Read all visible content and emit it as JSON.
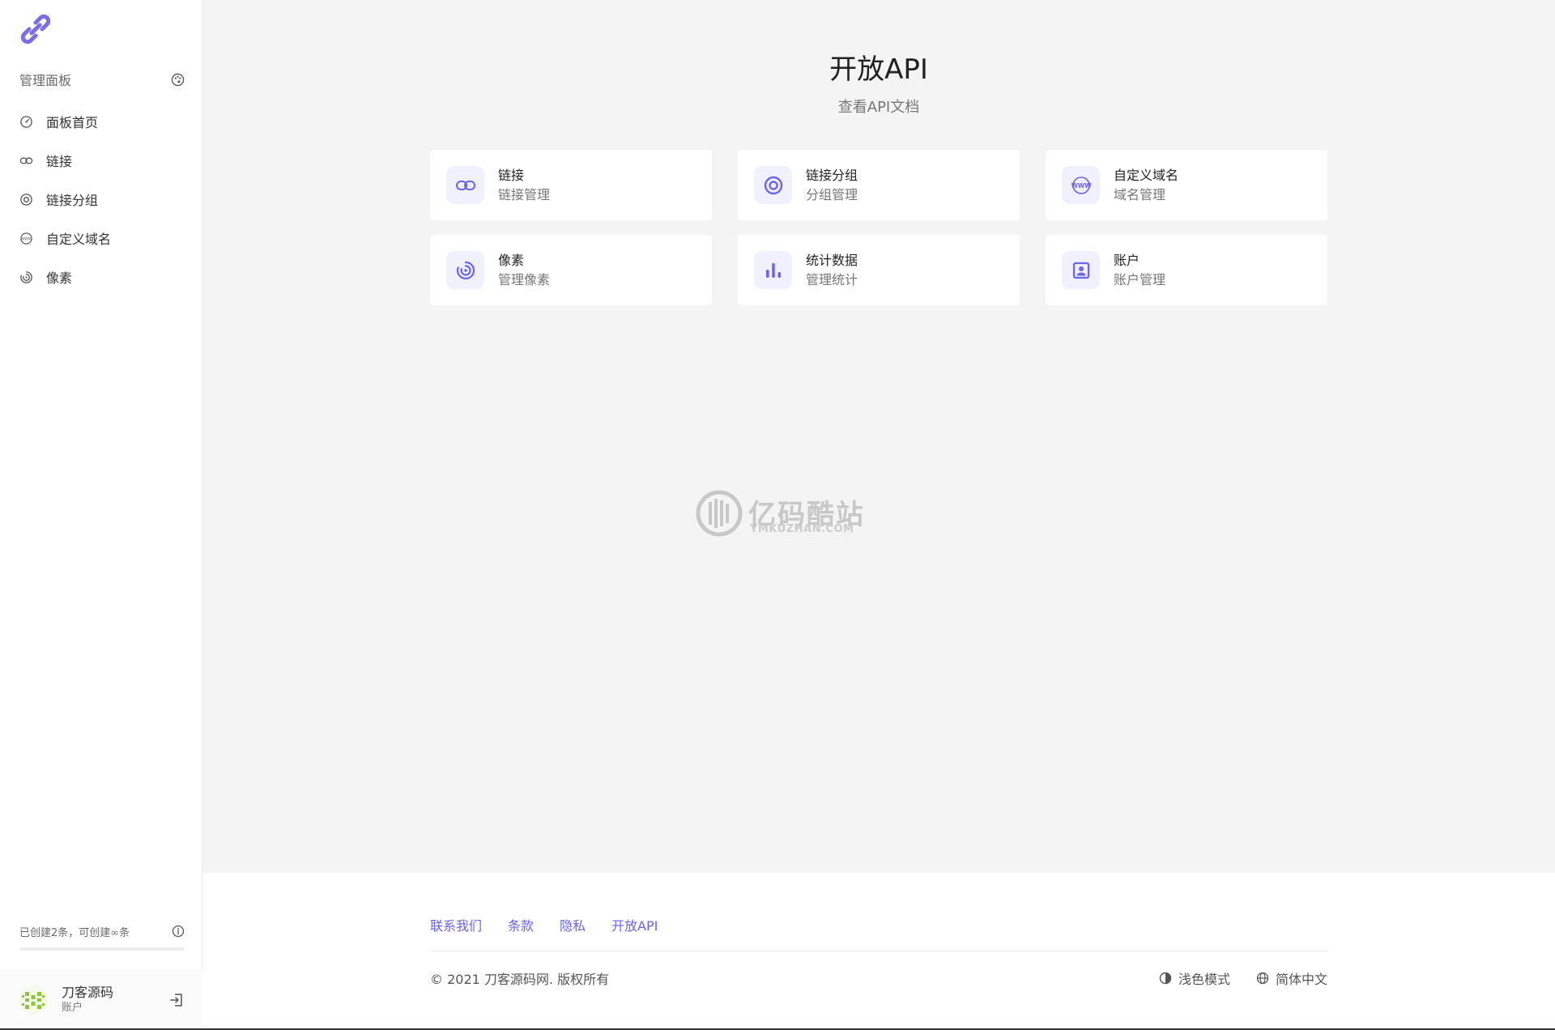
{
  "sidebar": {
    "header": "管理面板",
    "items": [
      {
        "label": "面板首页",
        "icon": "dashboard-icon"
      },
      {
        "label": "链接",
        "icon": "link-icon"
      },
      {
        "label": "链接分组",
        "icon": "target-icon"
      },
      {
        "label": "自定义域名",
        "icon": "www-icon"
      },
      {
        "label": "像素",
        "icon": "pixel-icon"
      }
    ],
    "quota": {
      "text": "已创建2条，可创建∞条",
      "fill": 0.0
    },
    "account": {
      "name": "刀客源码",
      "role": "账户"
    }
  },
  "main": {
    "title": "开放API",
    "subtitle": "查看API文档",
    "cards": [
      {
        "title": "链接",
        "subtitle": "链接管理",
        "icon": "link-icon"
      },
      {
        "title": "链接分组",
        "subtitle": "分组管理",
        "icon": "target-icon"
      },
      {
        "title": "自定义域名",
        "subtitle": "域名管理",
        "icon": "www-icon"
      },
      {
        "title": "像素",
        "subtitle": "管理像素",
        "icon": "pixel-icon"
      },
      {
        "title": "统计数据",
        "subtitle": "管理统计",
        "icon": "bar-chart-icon"
      },
      {
        "title": "账户",
        "subtitle": "账户管理",
        "icon": "account-icon"
      }
    ]
  },
  "watermark": {
    "cn": "亿码酷站",
    "en": "YMKUZHAN.COM"
  },
  "footer": {
    "links": [
      "联系我们",
      "条款",
      "隐私",
      "开放API"
    ],
    "copyright": "© 2021 刀客源码网. 版权所有",
    "theme": "浅色模式",
    "language": "简体中文"
  },
  "colors": {
    "accent": "#6b63f5",
    "icon_bg": "#f0f0ff"
  }
}
